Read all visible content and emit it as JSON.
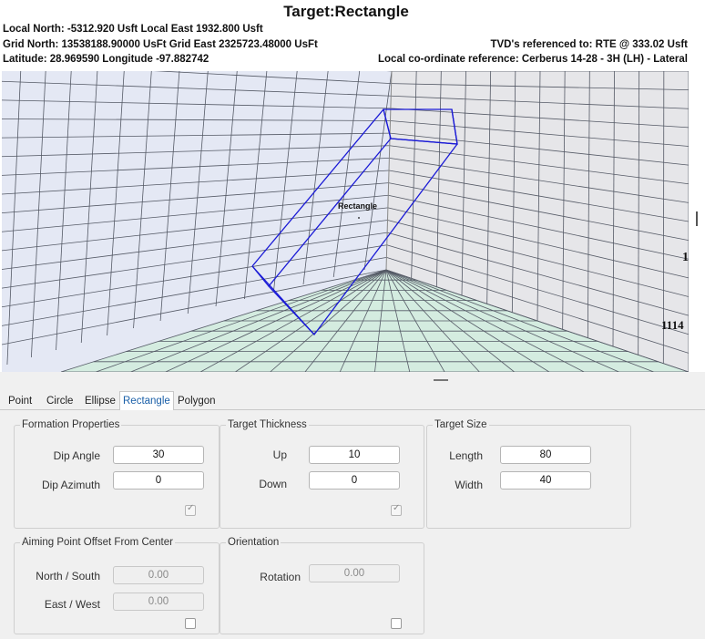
{
  "viewer": {
    "title": "Target:Rectangle",
    "local_coords": "Local North: -5312.920 Usft Local East 1932.800 Usft",
    "grid_coords": "Grid North: 13538188.90000 UsFt Grid East 2325723.48000 UsFt",
    "latlong": "Latitude: 28.969590 Longitude -97.882742",
    "tvd_reference": "TVD's referenced to: RTE @ 333.02 Usft",
    "local_reference": "Local co-ordinate reference: Cerberus 14-28 - 3H (LH) - Lateral",
    "target_label": "Rectangle",
    "axis_label_1": "1",
    "axis_label_2": "1114",
    "colors": {
      "target_outline": "#1a1ad6",
      "floor": "#d4ece0",
      "left_wall": "#dde3f2",
      "right_wall": "#e6e6e9",
      "back_wall": "#e4e8f4"
    }
  },
  "tabs": [
    {
      "label": "Point",
      "active": false
    },
    {
      "label": "Circle",
      "active": false
    },
    {
      "label": "Ellipse",
      "active": false
    },
    {
      "label": "Rectangle",
      "active": true
    },
    {
      "label": "Polygon",
      "active": false
    }
  ],
  "formation": {
    "title": "Formation Properties",
    "dip_angle_label": "Dip Angle",
    "dip_angle_value": "30",
    "dip_azimuth_label": "Dip Azimuth",
    "dip_azimuth_value": "0",
    "checkbox_checked": true
  },
  "thickness": {
    "title": "Target Thickness",
    "up_label": "Up",
    "up_value": "10",
    "down_label": "Down",
    "down_value": "0",
    "checkbox_checked": true
  },
  "size": {
    "title": "Target Size",
    "length_label": "Length",
    "length_value": "80",
    "width_label": "Width",
    "width_value": "40"
  },
  "offset": {
    "title": "Aiming Point Offset From Center",
    "ns_label": "North / South",
    "ns_value": "0.00",
    "ew_label": "East / West",
    "ew_value": "0.00",
    "checkbox_checked": false
  },
  "orientation": {
    "title": "Orientation",
    "rotation_label": "Rotation",
    "rotation_value": "0.00",
    "checkbox_checked": false
  }
}
